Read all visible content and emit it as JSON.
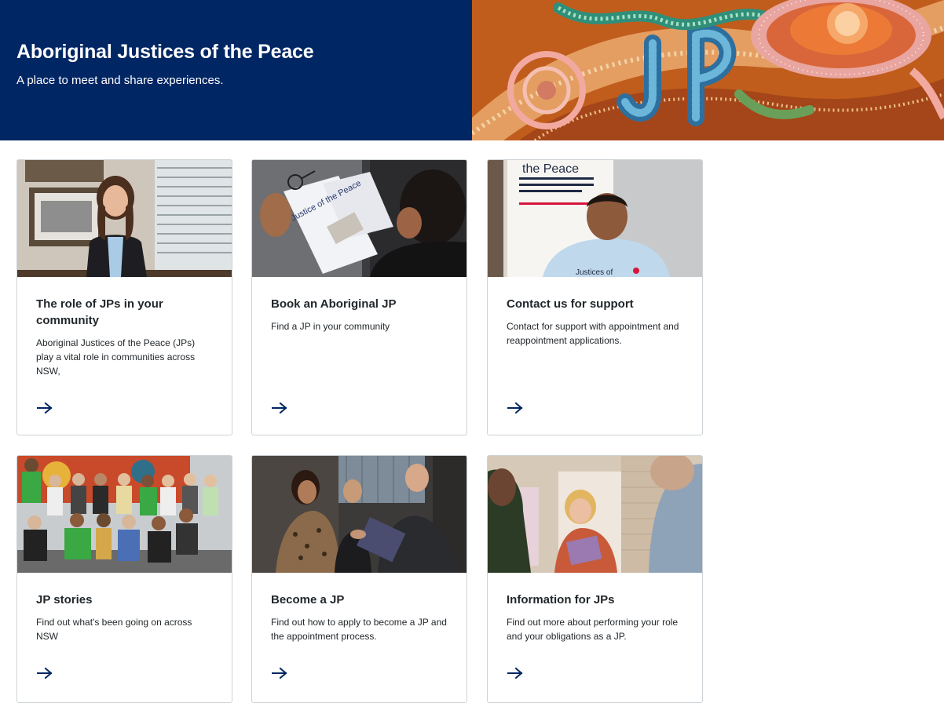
{
  "hero": {
    "title": "Aboriginal Justices of the Peace",
    "subtitle": "A place to meet and share experiences.",
    "artwork_icon": "aboriginal-artwork-jp-illustration",
    "brand_color": "#002664"
  },
  "cards": [
    {
      "title": "The role of JPs in your community",
      "description": "Aboriginal Justices of the Peace (JPs) play a vital role in communities across NSW,",
      "image": "woman-in-office-photo",
      "arrow_icon": "arrow-right-icon"
    },
    {
      "title": "Book an Aboriginal JP",
      "description": "Find a JP in your community",
      "image": "justice-of-the-peace-brochure-photo",
      "image_text": "Justice of the Peace",
      "arrow_icon": "arrow-right-icon"
    },
    {
      "title": "Contact us for support",
      "description": "Contact for support with appointment and reappointment applications.",
      "image": "man-at-jp-stand-photo",
      "image_text": "the Peace",
      "arrow_icon": "arrow-right-icon"
    },
    {
      "title": "JP stories",
      "description": "Find out what's been going on across NSW",
      "image": "group-photo",
      "arrow_icon": "arrow-right-icon"
    },
    {
      "title": "Become a JP",
      "description": "Find out how to apply to become a JP and the appointment process.",
      "image": "handshake-ceremony-photo",
      "arrow_icon": "arrow-right-icon"
    },
    {
      "title": "Information for JPs",
      "description": "Find out more about performing your role and your obligations as a JP.",
      "image": "smiling-woman-photo",
      "arrow_icon": "arrow-right-icon"
    }
  ],
  "colors": {
    "accent": "#002664",
    "card_border": "#cdd3d6",
    "text": "#22272b"
  }
}
